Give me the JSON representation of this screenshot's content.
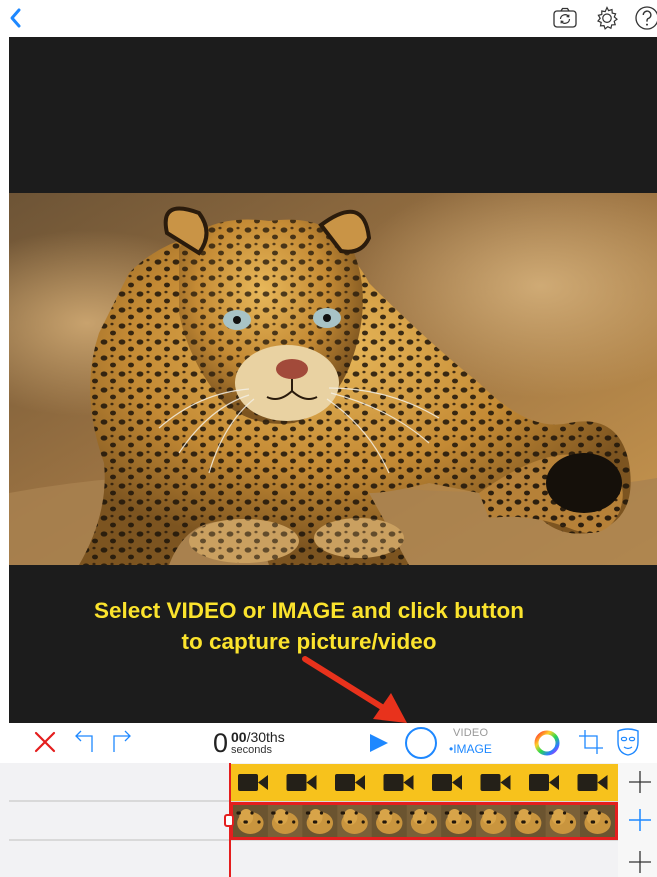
{
  "nav": {
    "back_icon": "chevron-left-icon",
    "icons": [
      "camera-switch-icon",
      "settings-gear-icon",
      "help-icon"
    ]
  },
  "preview": {
    "hint_line1": "Select VIDEO or IMAGE and click button",
    "hint_line2": "to capture picture/video",
    "hint_color": "#fbe32d"
  },
  "toolbar": {
    "time_seconds": "0",
    "time_fraction": "00",
    "time_fraction_unit": "/30ths",
    "time_unit_label": "seconds",
    "mode_video_label": "VIDEO",
    "mode_image_label": "•IMAGE",
    "selected_mode": "IMAGE",
    "accent_color": "#1e88ff",
    "delete_color": "#e41e1e"
  },
  "timeline": {
    "video_track_color": "#f7c21c",
    "video_clip_count": 8,
    "image_thumb_count": 11,
    "playhead_color": "#e41e1e"
  }
}
